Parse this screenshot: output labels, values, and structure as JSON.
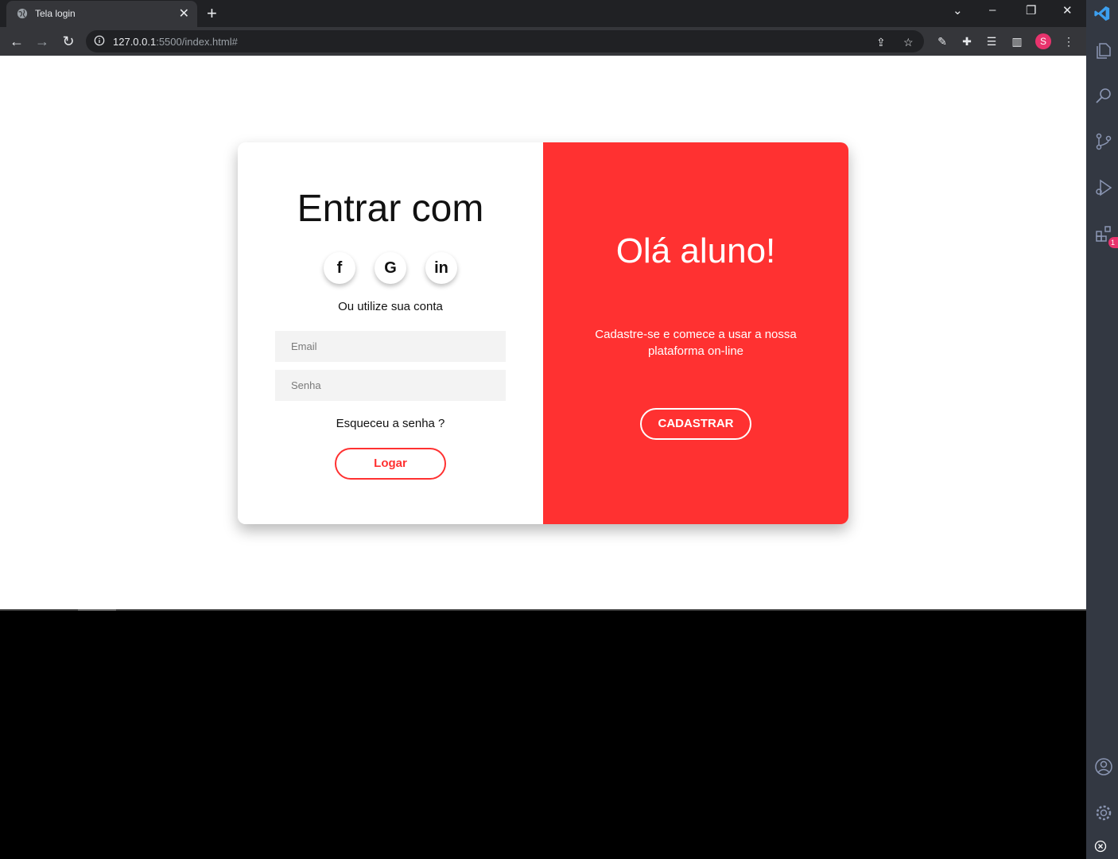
{
  "browser": {
    "tab_title": "Tela login",
    "tab_close": "✕",
    "new_tab": "+",
    "url_host": "127.0.0.1",
    "url_rest": ":5500/index.html#",
    "profile_initial": "S"
  },
  "login": {
    "title": "Entrar com",
    "socials": [
      {
        "label": "f",
        "name": "facebook"
      },
      {
        "label": "G",
        "name": "google"
      },
      {
        "label": "in",
        "name": "linkedin"
      }
    ],
    "alt_text": "Ou utilize sua conta",
    "email_placeholder": "Email",
    "password_placeholder": "Senha",
    "forgot": "Esqueceu a senha ?",
    "login_button": "Logar"
  },
  "signup_panel": {
    "title": "Olá aluno!",
    "text": "Cadastre-se e comece a usar a nossa plataforma on-line",
    "button": "CADASTRAR"
  },
  "vscode": {
    "extensions_badge": "1"
  },
  "colors": {
    "accent": "#ff3131",
    "chrome_dark": "#202124",
    "chrome_toolbar": "#35363a",
    "vscode_activity": "#333842"
  }
}
